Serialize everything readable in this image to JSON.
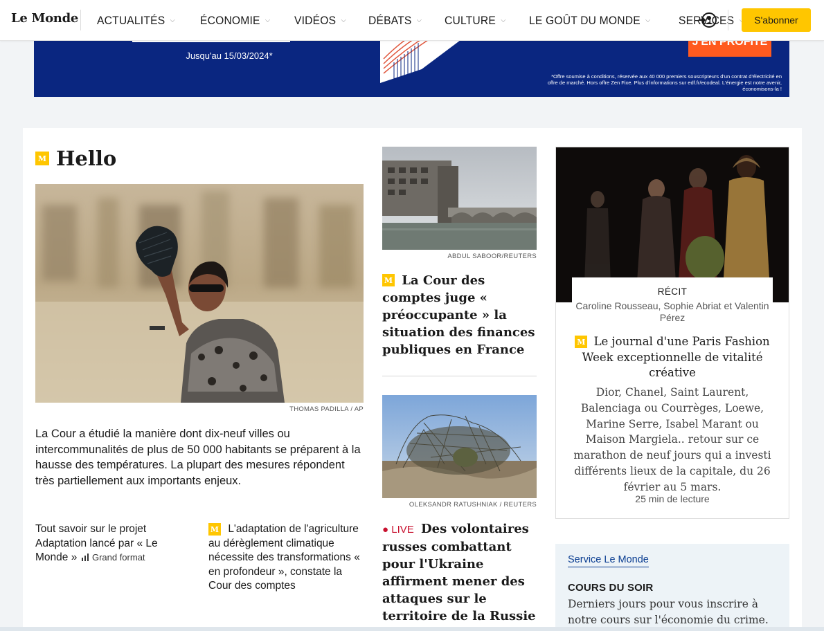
{
  "header": {
    "logo": "Le Monde",
    "nav": [
      {
        "label": "ACTUALITÉS"
      },
      {
        "label": "ÉCONOMIE"
      },
      {
        "label": "VIDÉOS"
      },
      {
        "label": "DÉBATS"
      },
      {
        "label": "CULTURE"
      },
      {
        "label": "LE GOÛT DU MONDE"
      },
      {
        "label": "SERVICES"
      }
    ],
    "subscribe_label": "S'abonner"
  },
  "ad": {
    "date_text": "Jusqu'au 15/03/2024*",
    "cta": "J'EN PROFITE",
    "legal": "*Offre soumise à conditions, réservée aux 40 000 premiers souscripteurs d'un contrat d'électricité en offre de marché. Hors offre Zen Fixe. Plus d'informations sur edf.fr/ecodeal. L'énergie est notre avenir, économisons-la !"
  },
  "main_story": {
    "title": "Hello",
    "photo_credit": "THOMAS PADILLA / AP",
    "lede": "La Cour a étudié la manière dont dix-neuf villes ou intercommunalités de plus de 50 000 habitants se préparent à la hausse des températures. La plupart des mesures répondent très partiellement aux importants enjeux.",
    "related1": "Tout savoir sur le projet Adaptation lancé par « Le Monde »",
    "related1_tag": "Grand format",
    "related2": "L'adaptation de l'agriculture au dérèglement climatique nécessite des transformations « en profondeur », constate la Cour des comptes"
  },
  "mid_story1": {
    "photo_credit": "ABDUL SABOOR/REUTERS",
    "headline": "La Cour des comptes juge « préoccupante » la situation des finances publiques en France"
  },
  "mid_story2": {
    "photo_credit": "OLEKSANDR RATUSHNIAK / REUTERS",
    "live_label": "LIVE",
    "headline": "Des volontaires russes combattant pour l'Ukraine affirment mener des attaques sur le territoire de la Russie"
  },
  "right_story": {
    "kicker": "RÉCIT",
    "authors": "Caroline Rousseau, Sophie Abriat et Valentin Pérez",
    "title": "Le journal d'une Paris Fashion Week exceptionnelle de vitalité créative",
    "description": "Dior, Chanel, Saint Laurent, Balenciaga ou Courrèges, Loewe, Marine Serre, Isabel Marant ou Maison Margiela.. retour sur ce marathon de neuf jours qui a investi différents lieux de la capitale, du 26 février au 5 mars.",
    "read_time": "25 min de lecture"
  },
  "service": {
    "label": "Service Le Monde",
    "title": "COURS DU SOIR",
    "text": "Derniers jours pour vous inscrire à notre cours sur l'économie du crime."
  },
  "colors": {
    "accent_yellow": "#ffc600",
    "ad_blue": "#0a2680",
    "ad_orange": "#ff5a1f",
    "live_red": "#c8102e"
  }
}
